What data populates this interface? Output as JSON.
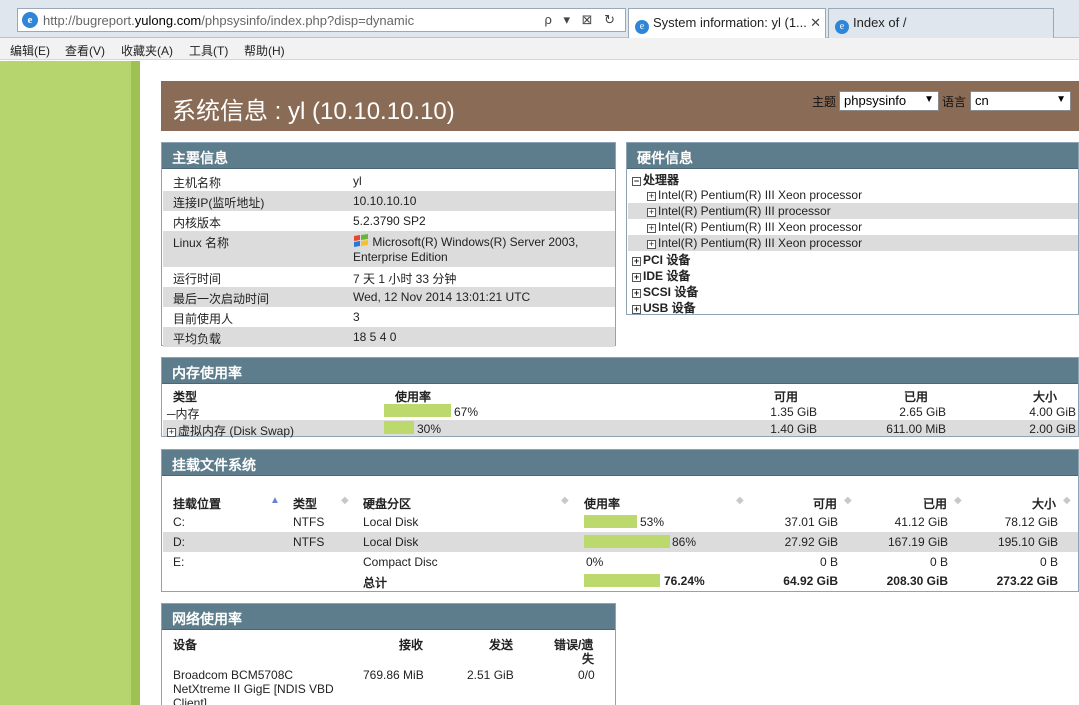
{
  "browser": {
    "url_prefix": "http://bugreport.",
    "url_domain": "yulong.com",
    "url_suffix": "/phpsysinfo/index.php?disp=dynamic",
    "url_tools": "ρ ▾ ⊠ ↻",
    "tabs": [
      {
        "label": "System information: yl (1...",
        "close": "✕"
      },
      {
        "label": "Index of /"
      }
    ],
    "menu": [
      "编辑(E)",
      "查看(V)",
      "收藏夹(A)",
      "工具(T)",
      "帮助(H)"
    ]
  },
  "banner": {
    "title": "系统信息 : yl (10.10.10.10)",
    "theme_label": "主题",
    "theme_value": "phpsysinfo",
    "lang_label": "语言",
    "lang_value": "cn"
  },
  "main_info": {
    "title": "主要信息",
    "rows": [
      {
        "label": "主机名称",
        "value": "yl"
      },
      {
        "label": "连接IP(监听地址)",
        "value": "10.10.10.10"
      },
      {
        "label": "内核版本",
        "value": "5.2.3790 SP2"
      },
      {
        "label": "Linux 名称",
        "value": "Microsoft(R) Windows(R) Server 2003,",
        "value2": "Enterprise Edition"
      },
      {
        "label": "运行时间",
        "value": "7 天 1 小时 33 分钟"
      },
      {
        "label": "最后一次启动时间",
        "value": "Wed, 12 Nov 2014 13:01:21 UTC"
      },
      {
        "label": "目前使用人",
        "value": "3"
      },
      {
        "label": "平均负载",
        "value": "18 5 4 0"
      }
    ]
  },
  "hardware": {
    "title": "硬件信息",
    "processor_label": "处理器",
    "processors": [
      "Intel(R) Pentium(R) III Xeon processor",
      "Intel(R) Pentium(R) III processor",
      "Intel(R) Pentium(R) III Xeon processor",
      "Intel(R) Pentium(R) III Xeon processor"
    ],
    "buses": [
      "PCI 设备",
      "IDE 设备",
      "SCSI 设备",
      "USB 设备"
    ]
  },
  "memory": {
    "title": "内存使用率",
    "headers": {
      "type": "类型",
      "usage": "使用率",
      "free": "可用",
      "used": "已用",
      "size": "大小"
    },
    "rows": [
      {
        "type": "内存",
        "percent": 67,
        "percent_label": "67%",
        "free": "1.35 GiB",
        "used": "2.65 GiB",
        "size": "4.00 GiB"
      },
      {
        "type": "虚拟内存 (Disk Swap)",
        "percent": 30,
        "percent_label": "30%",
        "free": "1.40 GiB",
        "used": "611.00 MiB",
        "size": "2.00 GiB"
      }
    ]
  },
  "filesystems": {
    "title": "挂载文件系统",
    "headers": {
      "mount": "挂载位置",
      "type": "类型",
      "partition": "硬盘分区",
      "usage": "使用率",
      "free": "可用",
      "used": "已用",
      "size": "大小"
    },
    "rows": [
      {
        "mount": "C:",
        "type": "NTFS",
        "partition": "Local Disk",
        "percent": 53,
        "percent_label": "53%",
        "free": "37.01 GiB",
        "used": "41.12 GiB",
        "size": "78.12 GiB"
      },
      {
        "mount": "D:",
        "type": "NTFS",
        "partition": "Local Disk",
        "percent": 86,
        "percent_label": "86%",
        "free": "27.92 GiB",
        "used": "167.19 GiB",
        "size": "195.10 GiB"
      },
      {
        "mount": "E:",
        "type": "",
        "partition": "Compact Disc",
        "percent": 0,
        "percent_label": "0%",
        "free": "0 B",
        "used": "0 B",
        "size": "0 B"
      }
    ],
    "total": {
      "label": "总计",
      "percent": 76.24,
      "percent_label": "76.24%",
      "free": "64.92 GiB",
      "used": "208.30 GiB",
      "size": "273.22 GiB"
    }
  },
  "network": {
    "title": "网络使用率",
    "headers": {
      "device": "设备",
      "received": "接收",
      "sent": "发送",
      "errors_line1": "错误/遗",
      "errors_line2": "失"
    },
    "rows": [
      {
        "device_line1": "Broadcom BCM5708C",
        "device_line2": "NetXtreme II GigE [NDIS VBD",
        "device_line3": "Client]",
        "received": "769.86 MiB",
        "sent": "2.51 GiB",
        "errors": "0/0"
      }
    ]
  }
}
